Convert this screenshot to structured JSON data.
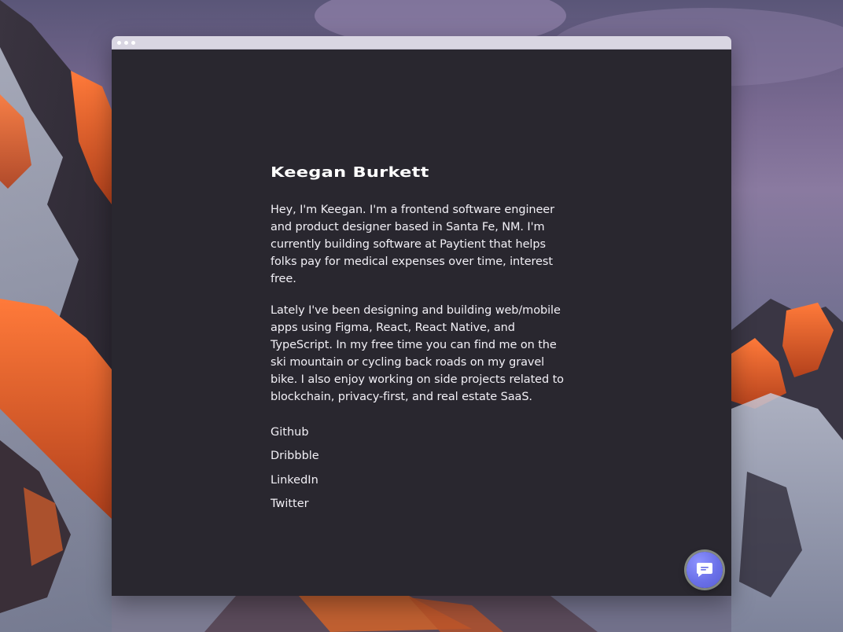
{
  "profile": {
    "name": "Keegan Burkett",
    "bio_paragraphs": [
      "Hey, I'm Keegan. I'm a frontend software engineer and product designer based in Santa Fe, NM. I'm currently building software at Paytient that helps folks pay for medical expenses over time, interest free.",
      "Lately I've been designing and building web/mobile apps using Figma, React, React Native, and TypeScript. In my free time you can find me on the ski mountain or cycling back roads on my gravel bike. I also enjoy working on side projects related to blockchain, privacy-first, and real estate SaaS."
    ],
    "links": [
      "Github",
      "Dribbble",
      "LinkedIn",
      "Twitter"
    ]
  },
  "window": {
    "controls": [
      "window-dot",
      "window-dot",
      "window-dot"
    ]
  },
  "chat": {
    "icon": "chat-bubble-icon"
  },
  "colors": {
    "page_background": "#29272f",
    "text": "#f2f0f6",
    "chat_accent": "#6a70e8",
    "titlebar": "#d9d6e2"
  }
}
